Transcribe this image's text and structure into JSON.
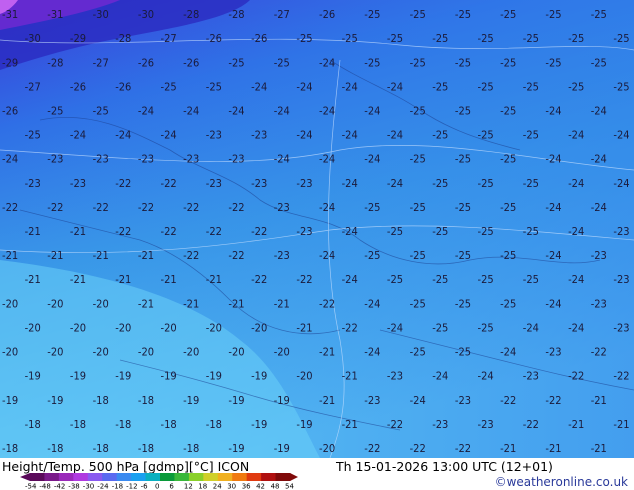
{
  "map": {
    "region": "Europe / Mediterranean",
    "description_labels_sample": "temperature contour labels in degrees C",
    "rows": [
      [
        "-31",
        "-31",
        "-30",
        "-30",
        "-28",
        "-28",
        "-27",
        "-26",
        "-25",
        "-25",
        "-25",
        "-25",
        "-25",
        "-25"
      ],
      [
        "-30",
        "-29",
        "-28",
        "-27",
        "-26",
        "-26",
        "-25",
        "-25",
        "-25",
        "-25",
        "-25",
        "-25",
        "-25",
        "-25"
      ],
      [
        "-29",
        "-28",
        "-27",
        "-26",
        "-26",
        "-25",
        "-25",
        "-24",
        "-25",
        "-25",
        "-25",
        "-25",
        "-25",
        "-25"
      ],
      [
        "-27",
        "-26",
        "-26",
        "-25",
        "-25",
        "-24",
        "-24",
        "-24",
        "-24",
        "-25",
        "-25",
        "-25",
        "-25",
        "-25"
      ],
      [
        "-26",
        "-25",
        "-25",
        "-24",
        "-24",
        "-24",
        "-24",
        "-24",
        "-24",
        "-25",
        "-25",
        "-25",
        "-24",
        "-24"
      ],
      [
        "-25",
        "-24",
        "-24",
        "-24",
        "-23",
        "-23",
        "-24",
        "-24",
        "-24",
        "-25",
        "-25",
        "-25",
        "-24",
        "-24"
      ],
      [
        "-24",
        "-23",
        "-23",
        "-23",
        "-23",
        "-23",
        "-24",
        "-24",
        "-24",
        "-25",
        "-25",
        "-25",
        "-24",
        "-24"
      ],
      [
        "-23",
        "-23",
        "-22",
        "-22",
        "-23",
        "-23",
        "-23",
        "-24",
        "-24",
        "-25",
        "-25",
        "-25",
        "-24",
        "-24"
      ],
      [
        "-22",
        "-22",
        "-22",
        "-22",
        "-22",
        "-22",
        "-23",
        "-24",
        "-25",
        "-25",
        "-25",
        "-25",
        "-24",
        "-24"
      ],
      [
        "-21",
        "-21",
        "-22",
        "-22",
        "-22",
        "-22",
        "-23",
        "-24",
        "-25",
        "-25",
        "-25",
        "-25",
        "-24",
        "-23"
      ],
      [
        "-21",
        "-21",
        "-21",
        "-21",
        "-22",
        "-22",
        "-23",
        "-24",
        "-25",
        "-25",
        "-25",
        "-25",
        "-24",
        "-23"
      ],
      [
        "-21",
        "-21",
        "-21",
        "-21",
        "-21",
        "-22",
        "-22",
        "-24",
        "-25",
        "-25",
        "-25",
        "-25",
        "-24",
        "-23"
      ],
      [
        "-20",
        "-20",
        "-20",
        "-21",
        "-21",
        "-21",
        "-21",
        "-22",
        "-24",
        "-25",
        "-25",
        "-25",
        "-24",
        "-23"
      ],
      [
        "-20",
        "-20",
        "-20",
        "-20",
        "-20",
        "-20",
        "-21",
        "-22",
        "-24",
        "-25",
        "-25",
        "-24",
        "-24",
        "-23"
      ],
      [
        "-20",
        "-20",
        "-20",
        "-20",
        "-20",
        "-20",
        "-20",
        "-21",
        "-24",
        "-25",
        "-25",
        "-24",
        "-23",
        "-22"
      ],
      [
        "-19",
        "-19",
        "-19",
        "-19",
        "-19",
        "-19",
        "-20",
        "-21",
        "-23",
        "-24",
        "-24",
        "-23",
        "-22",
        "-22"
      ],
      [
        "-19",
        "-19",
        "-18",
        "-18",
        "-19",
        "-19",
        "-19",
        "-21",
        "-23",
        "-24",
        "-23",
        "-22",
        "-22",
        "-21"
      ],
      [
        "-18",
        "-18",
        "-18",
        "-18",
        "-18",
        "-19",
        "-19",
        "-21",
        "-22",
        "-23",
        "-23",
        "-22",
        "-21",
        "-21"
      ],
      [
        "-18",
        "-18",
        "-18",
        "-18",
        "-18",
        "-19",
        "-19",
        "-20",
        "-22",
        "-22",
        "-22",
        "-21",
        "-21",
        "-21"
      ]
    ]
  },
  "footer": {
    "title_left": "Height/Temp. 500 hPa [gdmp][°C] ICON",
    "title_right": "Th 15-01-2026 13:00 UTC (12+01)",
    "credit": "©weatheronline.co.uk"
  },
  "colorbar": {
    "ticks": [
      "-54",
      "-48",
      "-42",
      "-38",
      "-30",
      "-24",
      "-18",
      "-12",
      "-6",
      "0",
      "6",
      "12",
      "18",
      "24",
      "30",
      "36",
      "42",
      "48",
      "54"
    ],
    "colors": [
      "#5a0a5a",
      "#7a1a8a",
      "#9a2aba",
      "#b03ae0",
      "#8a5af0",
      "#5a6af0",
      "#3a8af0",
      "#1aa0f0",
      "#0ab0c0",
      "#0a9a3a",
      "#3ab83a",
      "#8ad02a",
      "#d0d02a",
      "#f0b020",
      "#f07a10",
      "#e03a10",
      "#b01010",
      "#800a0a"
    ]
  }
}
